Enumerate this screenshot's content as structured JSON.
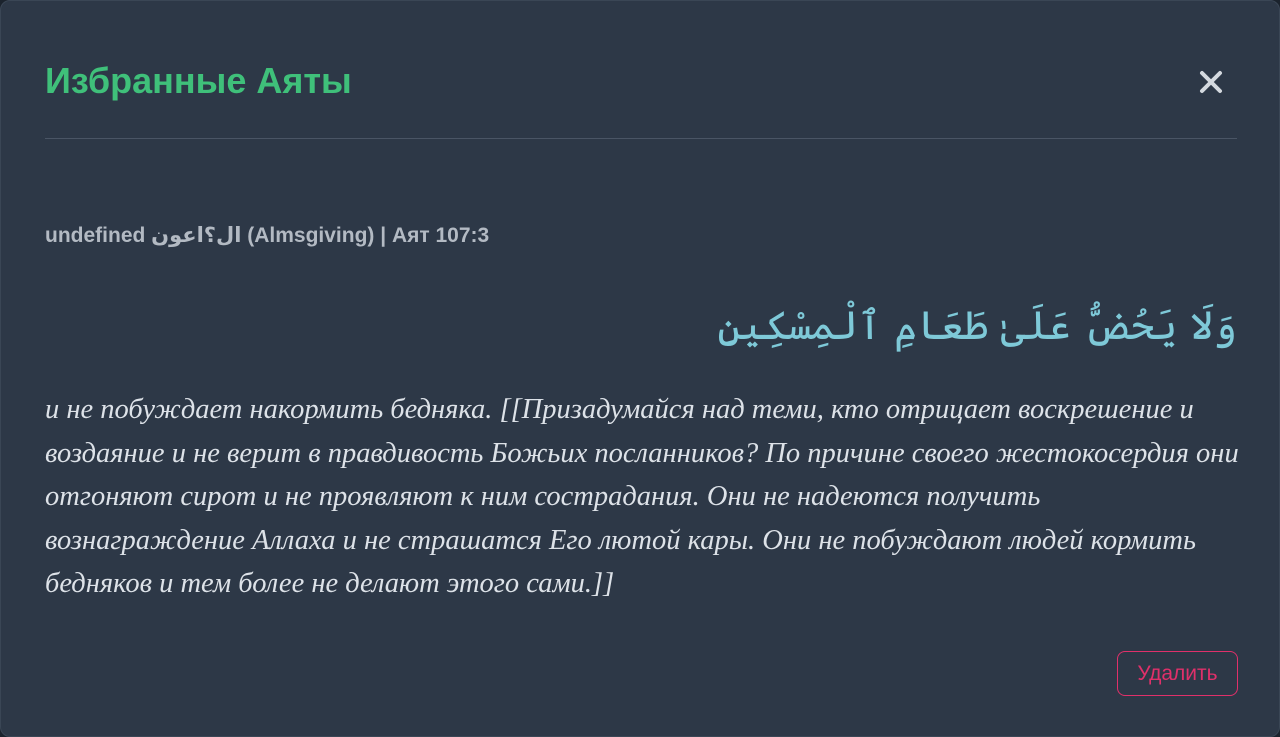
{
  "modal": {
    "title": "Избранные Аяты",
    "close_icon": "close-icon"
  },
  "ayah": {
    "meta": "undefined ال؟اعون (Almsgiving) | Аят 107:3",
    "arabic": "وَلَا يَحُضُّ عَلَىٰ طَعَامِ ٱلْمِسْكِينِ",
    "translation": "и не побуждает накормить бедняка. [[Призадумайся над теми, кто отрицает воскрешение и воздаяние и не верит в правдивость Божьих посланников? По причине своего жестокосердия они отгоняют сирот и не проявляют к ним сострадания. Они не надеются получить вознаграждение Аллаха и не страшатся Его лютой кары. Они не побуждают людей кормить бедняков и тем более не делают этого сами.]]"
  },
  "actions": {
    "delete_label": "Удалить"
  },
  "colors": {
    "background": "#2d3847",
    "title": "#3fc07a",
    "arabic": "#7ec9d8",
    "danger": "#e0306a"
  }
}
